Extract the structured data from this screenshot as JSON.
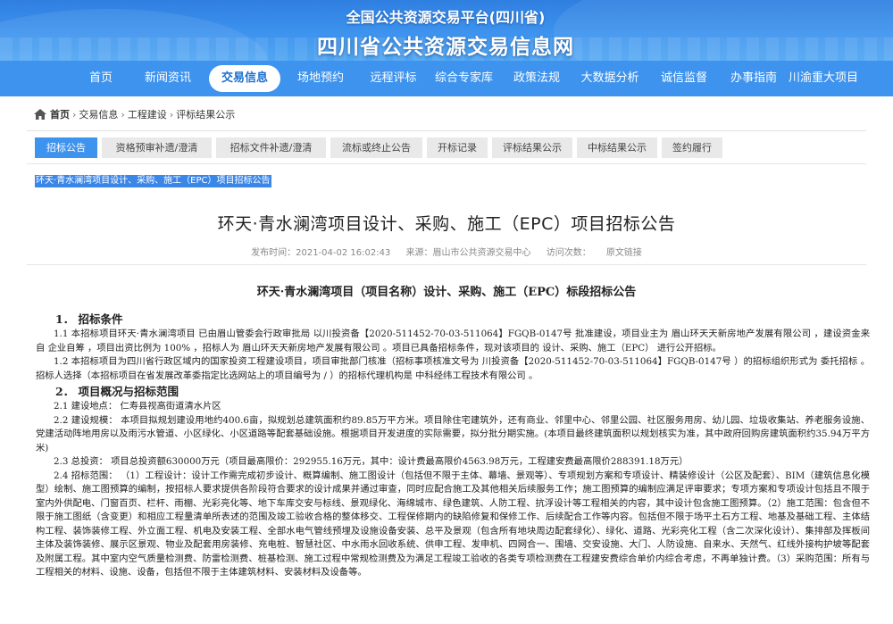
{
  "header": {
    "line1": "全国公共资源交易平台(四川省)",
    "line2": "四川省公共资源交易信息网"
  },
  "nav": [
    {
      "label": "首页"
    },
    {
      "label": "新闻资讯"
    },
    {
      "label": "交易信息",
      "active": true
    },
    {
      "label": "场地预约"
    },
    {
      "label": "远程评标"
    },
    {
      "label": "综合专家库"
    },
    {
      "label": "政策法规"
    },
    {
      "label": "大数据分析"
    },
    {
      "label": "诚信监督"
    },
    {
      "label": "办事指南"
    },
    {
      "label": "川渝重大项目"
    }
  ],
  "breadcrumb": {
    "home": "首页",
    "items": [
      "交易信息",
      "工程建设",
      "评标结果公示"
    ],
    "separator": "›"
  },
  "subtabs": [
    {
      "label": "招标公告",
      "active": true
    },
    {
      "label": "资格预审补遗/澄清"
    },
    {
      "label": "招标文件补遗/澄清"
    },
    {
      "label": "流标或终止公告"
    },
    {
      "label": "开标记录"
    },
    {
      "label": "评标结果公示"
    },
    {
      "label": "中标结果公示"
    },
    {
      "label": "签约履行"
    }
  ],
  "selected_text": "环天·青水澜湾项目设计、采购、施工（EPC）项目招标公告",
  "doc": {
    "title": "环天·青水澜湾项目设计、采购、施工（EPC）项目招标公告",
    "publish_time": "发布时间：2021-04-02 16:02:43",
    "source": "来源：眉山市公共资源交易中心",
    "visits": "访问次数：",
    "original_link": "原文链接"
  },
  "announcement_title": "环天·青水澜湾项目（项目名称）设计、采购、施工（EPC）标段招标公告",
  "body": {
    "h1": "1．  招标条件",
    "p1_1": "1.1    本招标项目环天·青水澜湾项目          已由眉山管委会行政审批局     以川投资备【2020-511452-70-03-511064】FGQB-0147号          批准建设，项目业主为    眉山环天天新房地产发展有限公司     ，建设资金来自    企业自筹    ，项目出资比例为    100%     ，招标人为    眉山环天天新房地产发展有限公司     。项目已具备招标条件，现对该项目的    设计、采购、施工（EPC）    进行公开招标。",
    "p1_2": "1.2 本招标项目为四川省行政区域内的国家投资工程建设项目，项目审批部门核准（招标事项核准文号为    川投资备【2020-511452-70-03-511064】FGQB-0147号    ）的招标组织形式为        委托招标      。招标人选择（本招标项目在省发展改革委指定比选网站上的项目编号为    /      ）的招标代理机构是          中科经纬工程技术有限公司          。",
    "h2": "2．  项目概况与招标范围",
    "p2_1": "2.1 建设地点：      仁寿县视高街道清水片区                                    ",
    "p2_2": "2.2 建设规模：      本项目拟规划建设用地约400.6亩，拟规划总建筑面积约89.85万平方米。项目除住宅建筑外，还有商业、邻里中心、邻里公园、社区服务用房、幼儿园、垃圾收集站、养老服务设施、党建活动阵地用房以及雨污水管道、小区绿化、小区道路等配套基础设施。根据项目开发进度的实际需要，拟分批分期实施。(本项目最终建筑面积以规划核实为准，其中政府回购房建筑面积约35.94万平方米)",
    "p2_3": "2.3 总投资：      项目总投资额630000万元（项目最高限价：292955.16万元，其中：设计费最高限价4563.98万元，工程建安费最高限价288391.18万元）",
    "p2_4": "2.4 招标范围：      （1）工程设计：设计工作需完成初步设计、概算编制、施工图设计（包括但不限于主体、幕墙、景观等）、专项规划方案和专项设计、精装修设计（公区及配套）、BIM（建筑信息化模型）绘制、施工图预算的编制，按招标人要求提供各阶段符合要求的设计成果并通过审查，同时应配合施工及其他相关后续服务工作；施工图预算的编制应满足评审要求；专项方案和专项设计包括且不限于室内外供配电、门窗百页、栏杆、雨棚、光彩亮化等、地下车库交安与标线、景观绿化、海绵城市、绿色建筑、人防工程、抗浮设计等工程相关的内容，其中设计包含施工图预算。（2）施工范围：包含但不限于施工图纸（含变更）和相应工程量清单所表述的范围及竣工验收合格的整体移交、工程保修期内的缺陷修复和保修工作、后续配合工作等内容。包括但不限于场平土石方工程、地基及基础工程、主体结构工程、装饰装修工程、外立面工程、机电及安装工程、全部水电气管线预埋及设施设备安装、总平及景观（包含所有地块周边配套绿化）、绿化、道路、光彩亮化工程（含二次深化设计）、集排部及挥板间主体及装饰装修、展示区景观、物业及配套用房装修、充电桩、智慧社区、中水雨水回收系统、供申工程、发申机、四网合一、围墙、交安设施、大门、人防设施、自来水、天然气、红线外接构护坡等配套及附属工程。其中室内空气质量检测费、防雷检测费、桩基检测、施工过程中常规检测费及为满足工程竣工验收的各类专项检测费在工程建安费综合单价内综合考虑，不再单独计费。（3）采购范围：所有与工程相关的材料、设施、设备，包括但不限于主体建筑材料、安装材料及设备等。"
  }
}
